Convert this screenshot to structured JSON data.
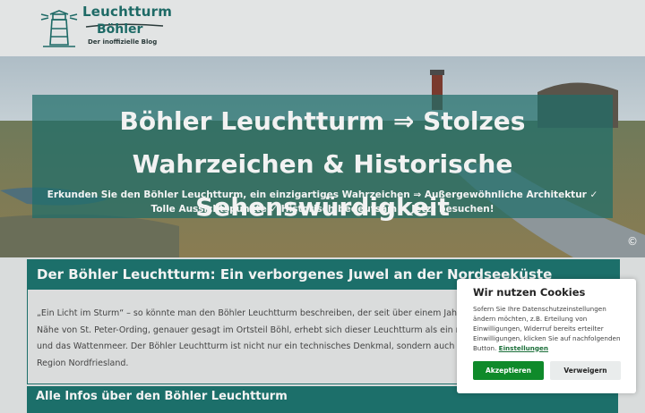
{
  "header": {
    "logo_line1": "Leuchtturm",
    "logo_line2": "Böhler",
    "logo_tagline": "Der inoffizielle Blog"
  },
  "hero": {
    "title": "Böhler Leuchtturm ⇒ Stolzes Wahrzeichen & Historische Sehenswürdigkeit",
    "subtitle": "Erkunden Sie den Böhler Leuchtturm, ein einzigartiges Wahrzeichen ⇒ Außergewöhnliche Architektur ✓ Tolle Aussichtspunkte ✓ Historisch bedeutsam ✓ Jetzt besuchen!",
    "copyright": "©"
  },
  "section1": {
    "heading": "Der Böhler Leuchtturm: Ein verborgenes Juwel an der Nordseeküste",
    "body": "„Ein Licht im Sturm“ – so könnte man den Böhler Leuchtturm beschreiben, der seit über einem Jahrhundert an der Küste steht. In der Nähe von St. Peter-Ording, genauer gesagt im Ortsteil Böhl, erhebt sich dieser Leuchtturm als ein ruhender Pol über den Salzwiesen und das Wattenmeer. Der Böhler Leuchtturm ist nicht nur ein technisches Denkmal, sondern auch ein beliebtes Wahrzeichen der Region Nordfriesland."
  },
  "section2": {
    "heading": "Alle Infos über den Böhler Leuchtturm"
  },
  "cookie": {
    "title": "Wir nutzen Cookies",
    "text": "Sofern Sie Ihre Datenschutzeinstellungen ändern möchten, z.B. Erteilung von Einwilligungen, Widerruf bereits erteilter Einwilligungen, klicken Sie auf nachfolgenden Button.",
    "link": "Einstellungen",
    "accept": "Akzeptieren",
    "deny": "Verweigern"
  },
  "colors": {
    "accent": "#1c6f6a",
    "accept_button": "#0f8a2a"
  }
}
